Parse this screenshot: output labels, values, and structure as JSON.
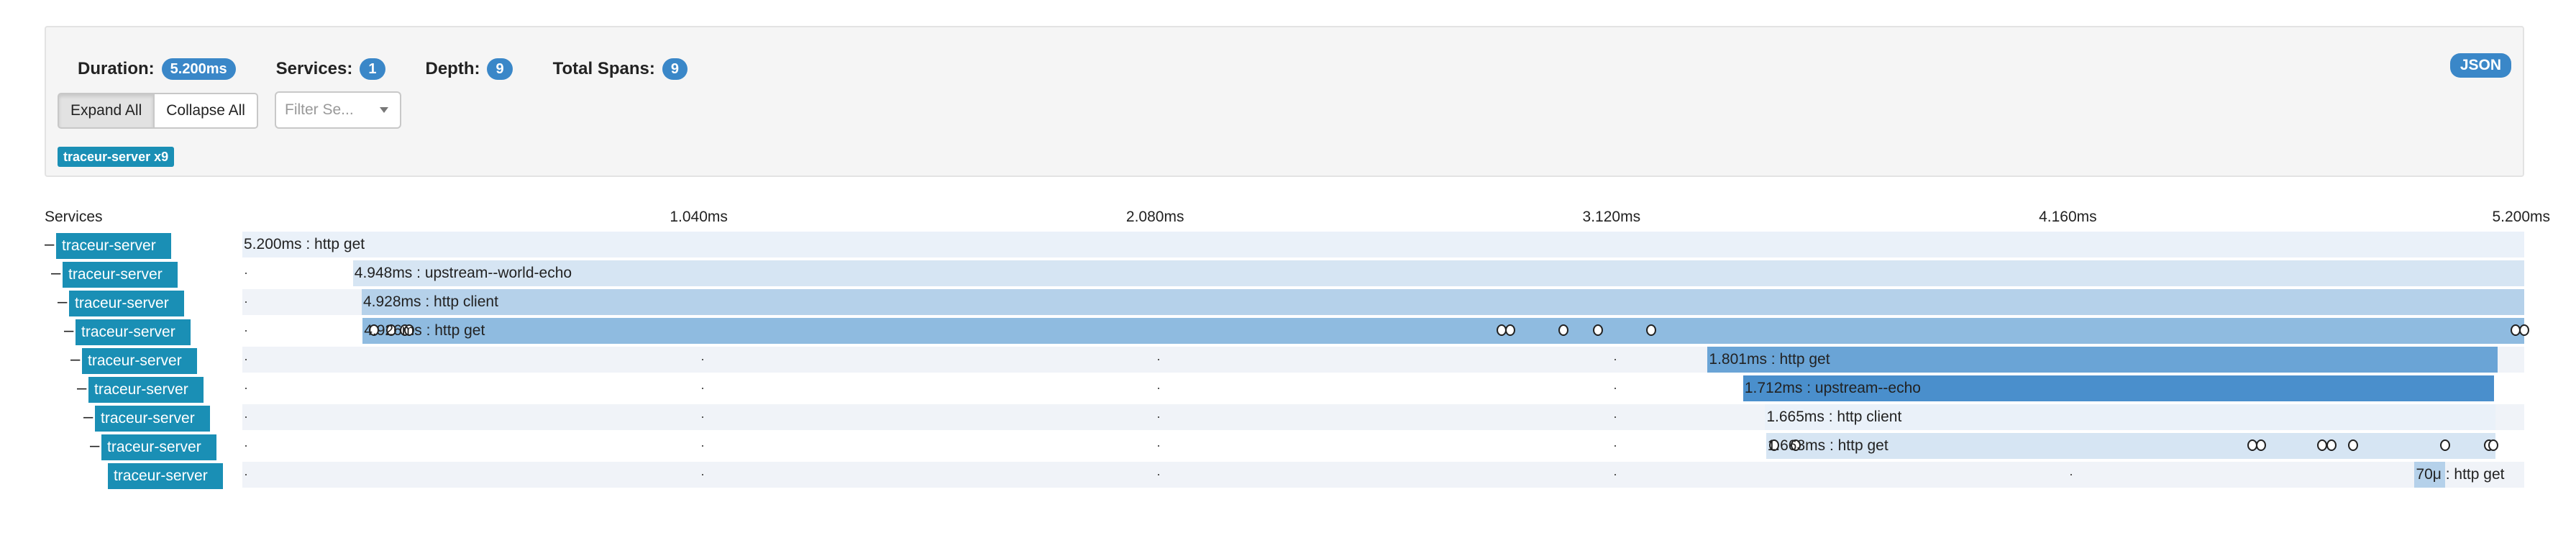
{
  "summary": {
    "duration_label": "Duration:",
    "duration_value": "5.200ms",
    "services_label": "Services:",
    "services_value": "1",
    "depth_label": "Depth:",
    "depth_value": "9",
    "total_spans_label": "Total Spans:",
    "total_spans_value": "9"
  },
  "json_button": "JSON",
  "controls": {
    "expand_all": "Expand All",
    "collapse_all": "Collapse All",
    "filter_placeholder": "Filter Se..."
  },
  "service_tag": "traceur-server x9",
  "timeline": {
    "services_header": "Services",
    "total_ms": 5.2,
    "ticks": [
      "1.040ms",
      "2.080ms",
      "3.120ms",
      "4.160ms",
      "5.200ms"
    ]
  },
  "spans": [
    {
      "service": "traceur-server",
      "label": "5.200ms : http get",
      "depth": 0,
      "start_ms": 0.0,
      "duration_ms": 5.2,
      "color": "#eaf1f9",
      "collapsible": true,
      "annotations_ms": []
    },
    {
      "service": "traceur-server",
      "label": "4.948ms : upstream--world-echo",
      "depth": 1,
      "start_ms": 0.252,
      "duration_ms": 4.948,
      "color": "#d6e5f3",
      "collapsible": true,
      "annotations_ms": []
    },
    {
      "service": "traceur-server",
      "label": "4.928ms : http client",
      "depth": 2,
      "start_ms": 0.272,
      "duration_ms": 4.928,
      "color": "#b5d1ea",
      "collapsible": true,
      "annotations_ms": []
    },
    {
      "service": "traceur-server",
      "label": "4.926ms : http get",
      "depth": 3,
      "start_ms": 0.274,
      "duration_ms": 4.926,
      "color": "#8fbbe0",
      "collapsible": true,
      "annotations_ms": [
        0.3,
        0.34,
        0.37,
        0.38,
        2.87,
        2.89,
        3.01,
        3.09,
        3.21,
        5.18,
        5.2
      ]
    },
    {
      "service": "traceur-server",
      "label": "1.801ms : http get",
      "depth": 4,
      "start_ms": 3.339,
      "duration_ms": 1.801,
      "color": "#6aa4d6",
      "collapsible": true,
      "annotations_ms": []
    },
    {
      "service": "traceur-server",
      "label": "1.712ms : upstream--echo",
      "depth": 5,
      "start_ms": 3.42,
      "duration_ms": 1.712,
      "color": "#4a8fcc",
      "collapsible": true,
      "annotations_ms": []
    },
    {
      "service": "traceur-server",
      "label": "1.665ms : http client",
      "depth": 6,
      "start_ms": 3.47,
      "duration_ms": 1.665,
      "color": "#eaf1f9",
      "collapsible": true,
      "annotations_ms": []
    },
    {
      "service": "traceur-server",
      "label": "1.663ms : http get",
      "depth": 7,
      "start_ms": 3.472,
      "duration_ms": 1.663,
      "color": "#d6e5f3",
      "collapsible": true,
      "annotations_ms": [
        3.49,
        3.54,
        4.58,
        4.6,
        4.74,
        4.76,
        4.81,
        5.02,
        5.12,
        5.13
      ]
    },
    {
      "service": "traceur-server",
      "label": "70μ : http get",
      "depth": 8,
      "start_ms": 4.95,
      "duration_ms": 0.07,
      "color": "#b5d1ea",
      "collapsible": false,
      "annotations_ms": []
    }
  ]
}
